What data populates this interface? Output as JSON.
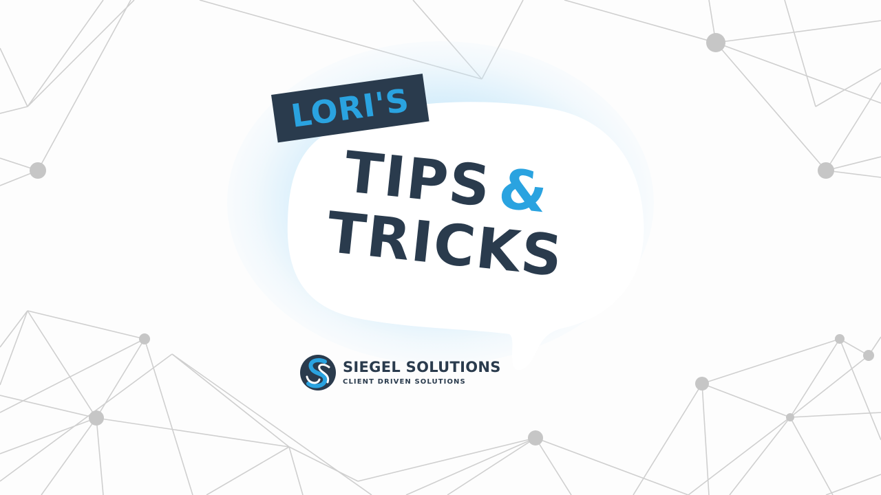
{
  "title_card": {
    "tag_label": "LORI'S",
    "headline_word1": "TIPS",
    "headline_amp": "&",
    "headline_word2": "TRICKS"
  },
  "brand": {
    "name": "SIEGEL SOLUTIONS",
    "tagline": "CLIENT DRIVEN SOLUTIONS",
    "logo_icon": "siegel-s-logo-icon"
  },
  "colors": {
    "navy": "#2a3b4d",
    "accent_blue": "#2aa3e0",
    "network_gray": "#c6c6c6",
    "glow_blue": "#a9dcf5"
  }
}
